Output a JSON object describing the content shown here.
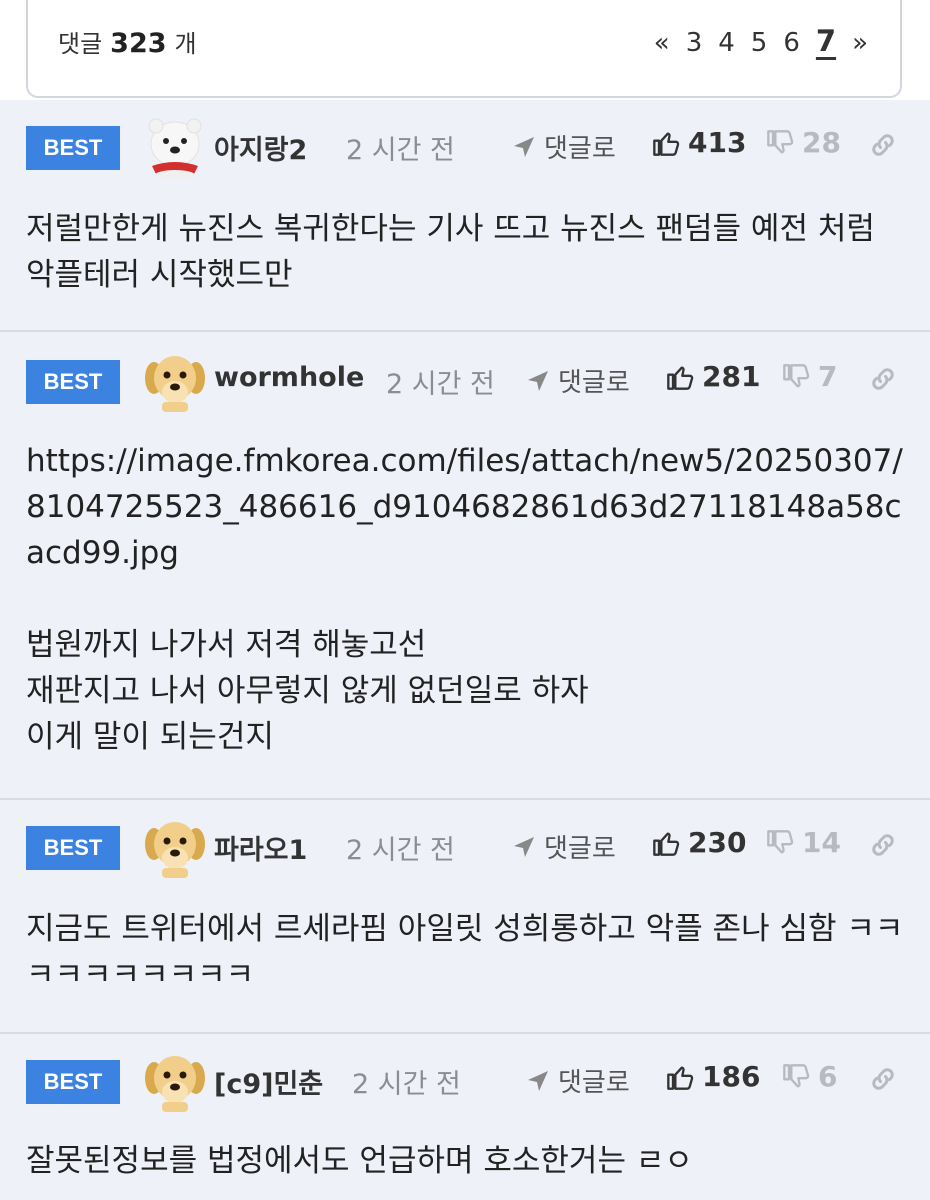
{
  "header": {
    "count_label": "댓글",
    "count_value": "323",
    "count_unit": "개",
    "pager": {
      "prev": "«",
      "pages": [
        "3",
        "4",
        "5",
        "6"
      ],
      "current": "7",
      "next": "»"
    }
  },
  "comments": [
    {
      "badge": "BEST",
      "author": "아지랑2",
      "avatar": "polar-bear-avatar",
      "time": "2 시간 전",
      "reply_label": "댓글로",
      "upvotes": "413",
      "downvotes": "28",
      "text": "저럴만한게 뉴진스 복귀한다는 기사 뜨고 뉴진스 팬덤들 예전 처럼 악플테러 시작했드만"
    },
    {
      "badge": "BEST",
      "author": "wormhole",
      "avatar": "puppy-avatar",
      "time": "2 시간 전",
      "reply_label": "댓글로",
      "upvotes": "281",
      "downvotes": "7",
      "text": "https://image.fmkorea.com/files/attach/new5/20250307/8104725523_486616_d9104682861d63d27118148a58cacd99.jpg\n\n법원까지 나가서 저격 해놓고선\n재판지고 나서 아무렇지 않게 없던일로 하자\n이게 말이 되는건지"
    },
    {
      "badge": "BEST",
      "author": "파라오1",
      "avatar": "puppy-avatar",
      "time": "2 시간 전",
      "reply_label": "댓글로",
      "upvotes": "230",
      "downvotes": "14",
      "text": "지금도 트위터에서 르세라핌 아일릿 성희롱하고 악플 존나 심함 ㅋㅋㅋㅋㅋㅋㅋㅋㅋㅋ"
    },
    {
      "badge": "BEST",
      "author": "[c9]민춘",
      "avatar": "puppy-avatar",
      "time": "2 시간 전",
      "reply_label": "댓글로",
      "upvotes": "186",
      "downvotes": "6",
      "text": "잘못된정보를 법정에서도 언급하며 호소한거는 ㄹㅇ"
    }
  ],
  "colors": {
    "best_badge": "#3c82e0",
    "background": "#eef1f8",
    "muted": "#8a8d93"
  }
}
